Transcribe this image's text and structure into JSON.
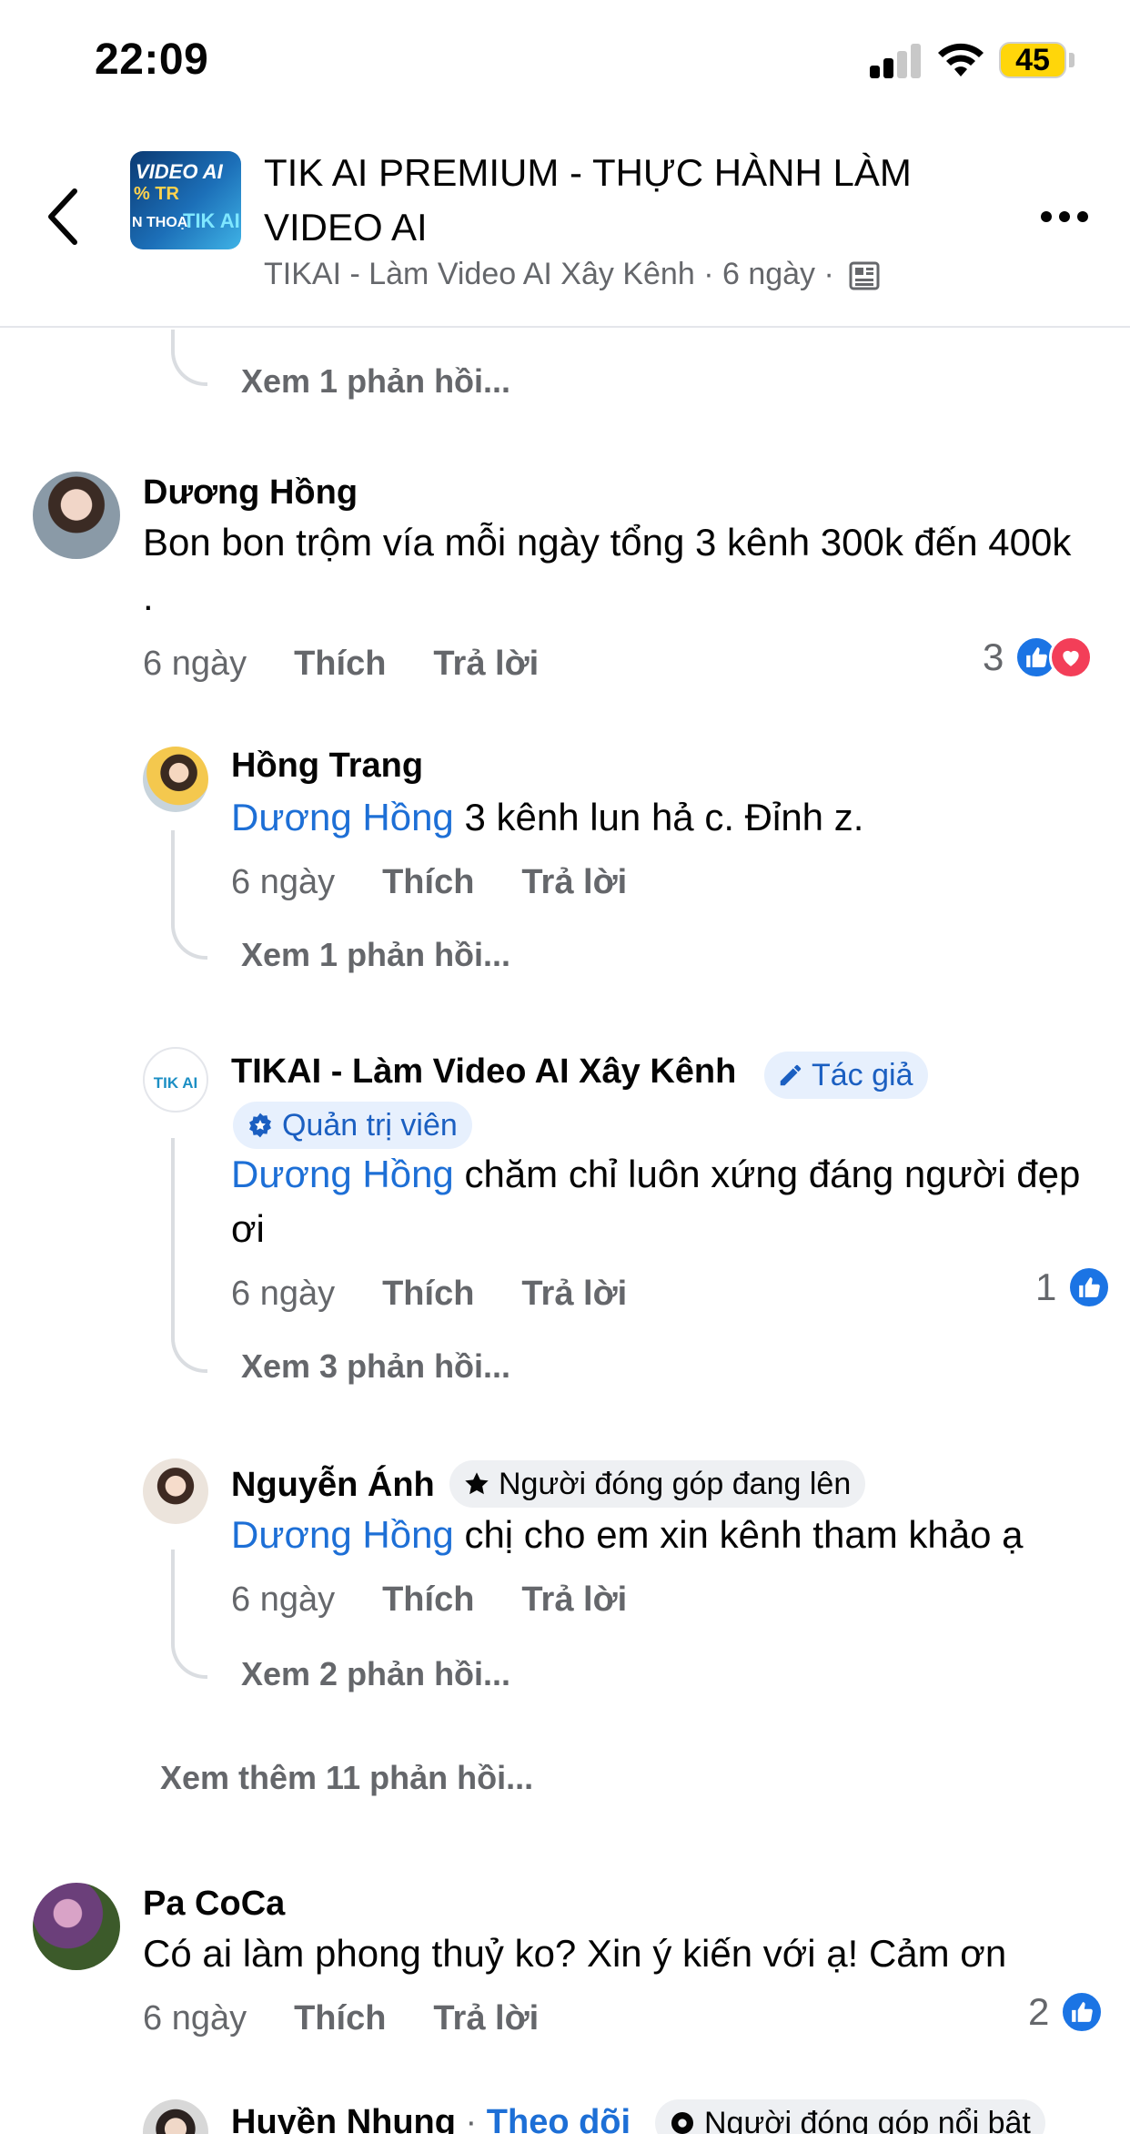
{
  "status_bar": {
    "time": "22:09",
    "battery": "45"
  },
  "header": {
    "group_thumb": {
      "line1": "VIDEO AI",
      "line2": "% TR",
      "line3": "N THOẠ",
      "line4": "TIK AI"
    },
    "title": "TIK AI PREMIUM - THỰC HÀNH LÀM VIDEO AI",
    "subtitle": "TIKAI - Làm Video AI Xây Kênh · 6 ngày ·"
  },
  "thread": {
    "top_view_replies": "Xem 1 phản hồi...",
    "comments": [
      {
        "author": "Dương Hồng",
        "text": "Bon bon trộm vía mỗi ngày tổng 3 kênh 300k đến 400k .",
        "time": "6 ngày",
        "like": "Thích",
        "reply": "Trả lời",
        "reaction_count": "3",
        "replies": [
          {
            "author": "Hồng Trang",
            "mention": "Dương Hồng",
            "text": " 3 kênh lun hả c. Đỉnh z.",
            "time": "6 ngày",
            "like": "Thích",
            "reply": "Trả lời",
            "view_replies": "Xem 1 phản hồi..."
          },
          {
            "author": "TIKAI - Làm Video AI Xây Kênh",
            "badge_author": "Tác giả",
            "badge_admin": "Quản trị viên",
            "avatar_text": "TIK AI",
            "mention": "Dương Hồng",
            "text": " chăm chỉ luôn xứng đáng người đẹp ơi",
            "time": "6 ngày",
            "like": "Thích",
            "reply": "Trả lời",
            "reaction_count": "1",
            "view_replies": "Xem 3 phản hồi..."
          },
          {
            "author": "Nguyễn Ánh",
            "badge": "Người đóng góp đang lên",
            "mention": "Dương Hồng",
            "text": " chị cho em xin kênh tham khảo ạ",
            "time": "6 ngày",
            "like": "Thích",
            "reply": "Trả lời",
            "view_replies": "Xem 2 phản hồi..."
          }
        ],
        "view_more": "Xem thêm 11 phản hồi..."
      },
      {
        "author": "Pa CoCa",
        "text": "Có ai làm phong thuỷ ko? Xin ý kiến với ạ! Cảm ơn",
        "time": "6 ngày",
        "like": "Thích",
        "reply": "Trả lời",
        "reaction_count": "2"
      },
      {
        "author": "Huyền Nhung",
        "separator": " · ",
        "follow": "Theo dõi",
        "badge": "Người đóng góp nổi bật"
      }
    ]
  },
  "colors": {
    "like_blue": "#1b74e4",
    "love_red": "#f33e58",
    "mention_blue": "#1d6fd6",
    "meta_gray": "#65676b",
    "battery_yellow": "#ffd60a"
  },
  "icons": [
    "back-chevron-icon",
    "more-dots-icon",
    "signal-icon",
    "wifi-icon",
    "battery-icon",
    "photo-album-icon",
    "like-icon",
    "love-icon",
    "pencil-icon",
    "admin-shield-icon",
    "star-icon",
    "gear-badge-icon"
  ]
}
